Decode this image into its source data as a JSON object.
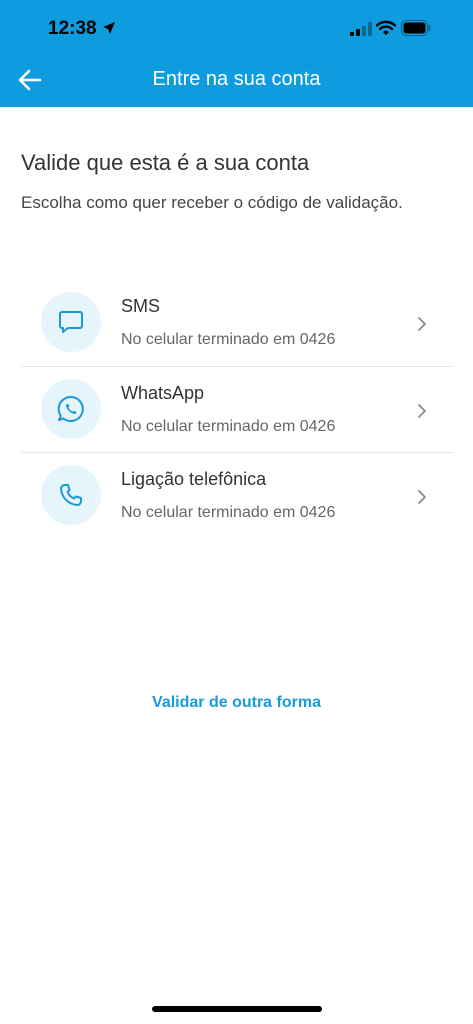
{
  "status_bar": {
    "time": "12:38"
  },
  "nav": {
    "title": "Entre na sua conta"
  },
  "page": {
    "heading": "Valide que esta é a sua conta",
    "subtitle": "Escolha como quer receber o código de validação."
  },
  "options": [
    {
      "title": "SMS",
      "description": "No celular terminado em 0426",
      "icon": "chat-bubble-icon"
    },
    {
      "title": "WhatsApp",
      "description": "No celular terminado em 0426",
      "icon": "whatsapp-icon"
    },
    {
      "title": "Ligação telefônica",
      "description": "No celular terminado em 0426",
      "icon": "phone-icon"
    }
  ],
  "alt_link": "Validar de outra forma",
  "colors": {
    "accent": "#0f9cdf",
    "icon_bg": "#e6f4fb",
    "link": "#1a9bd7"
  }
}
